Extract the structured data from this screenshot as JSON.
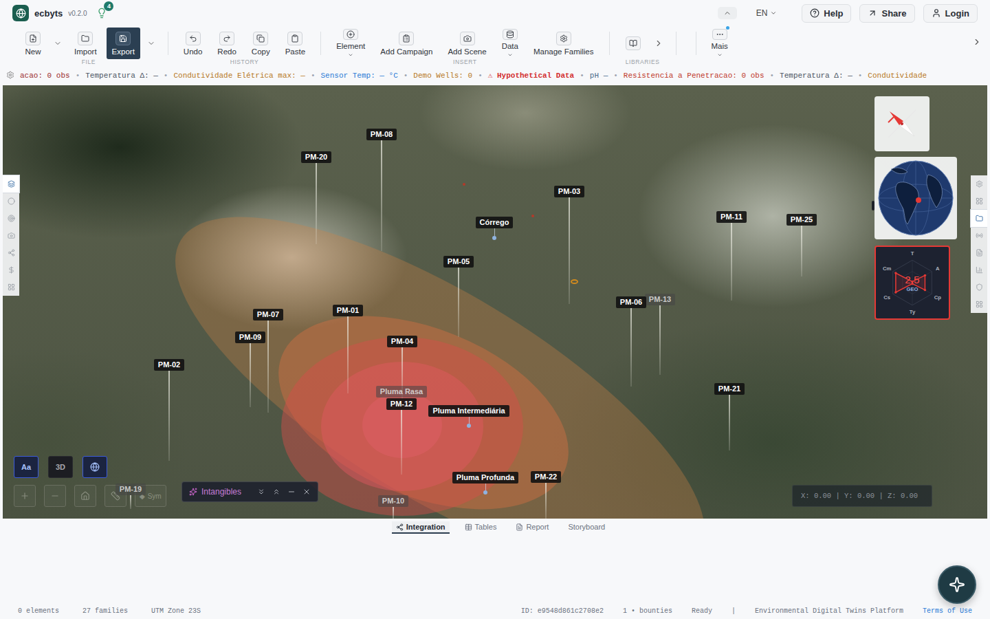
{
  "app": {
    "name": "ecbyts",
    "version": "v0.2.0",
    "notifications": "4"
  },
  "header_actions": {
    "language": "EN",
    "buttons": [
      "Help",
      "Share",
      "Login"
    ]
  },
  "toolbar": {
    "groups": [
      {
        "label": "FILE",
        "items": [
          {
            "kind": "button",
            "label": "New",
            "selected": false
          },
          {
            "kind": "caret",
            "selected": false
          },
          {
            "kind": "button",
            "label": "Import",
            "selected": false
          },
          {
            "kind": "button",
            "label": "Export",
            "selected": true
          },
          {
            "kind": "caret",
            "selected": false
          }
        ]
      },
      {
        "label": "HISTORY",
        "items": [
          {
            "kind": "button",
            "label": "Undo",
            "selected": false
          },
          {
            "kind": "button",
            "label": "Redo",
            "selected": false
          },
          {
            "kind": "button",
            "label": "Copy",
            "selected": false
          },
          {
            "kind": "button",
            "label": "Paste",
            "selected": false
          }
        ]
      },
      {
        "label": "INSERT",
        "items": [
          {
            "kind": "menu",
            "label": "Element",
            "selected": false
          },
          {
            "kind": "button",
            "label": "Add Campaign",
            "selected": false
          },
          {
            "kind": "button",
            "label": "Add Scene",
            "selected": false
          },
          {
            "kind": "menu",
            "label": "Data",
            "selected": false
          },
          {
            "kind": "button",
            "label": "Manage Families",
            "selected": false
          }
        ]
      },
      {
        "label": "LIBRARIES",
        "items": [
          {
            "kind": "icon",
            "selected": false
          },
          {
            "kind": "arrow",
            "selected": false
          }
        ]
      }
    ],
    "more": {
      "label": "Mais",
      "dot": true
    }
  },
  "ticker": {
    "separator": "•",
    "items": [
      {
        "text": "acao: 0 obs",
        "color": "#9b2c2c"
      },
      {
        "text": "Temperatura Δ: —",
        "color": "#4b5563"
      },
      {
        "text": "Condutividade Elétrica max: —",
        "color": "#b7791f"
      },
      {
        "text": "Sensor Temp: — °C",
        "color": "#2b7bd6"
      },
      {
        "text": "Demo Wells: 0",
        "color": "#b7791f"
      },
      {
        "text": "⚠ Hypothetical Data",
        "color": "#d32f2f"
      },
      {
        "text": "pH —",
        "color": "#4a6a8a"
      },
      {
        "text": "Resistencia a Penetracao: 0 obs",
        "color": "#c0392b"
      },
      {
        "text": "Temperatura Δ: —",
        "color": "#4b5563"
      },
      {
        "text": "Condutividade",
        "color": "#b7791f"
      }
    ]
  },
  "map": {
    "wells": [
      {
        "label": "PM-08",
        "kind": "well",
        "dimmed": false
      },
      {
        "label": "PM-20",
        "kind": "well",
        "dimmed": false
      },
      {
        "label": "PM-03",
        "kind": "well",
        "dimmed": false
      },
      {
        "label": "Córrego",
        "kind": "point",
        "dimmed": false
      },
      {
        "label": "PM-11",
        "kind": "well",
        "dimmed": false
      },
      {
        "label": "PM-25",
        "kind": "well",
        "dimmed": false
      },
      {
        "label": "PM-05",
        "kind": "well",
        "dimmed": false
      },
      {
        "label": "PM-07",
        "kind": "well",
        "dimmed": false
      },
      {
        "label": "PM-01",
        "kind": "well",
        "dimmed": false
      },
      {
        "label": "PM-13",
        "kind": "well",
        "dimmed": true
      },
      {
        "label": "PM-06",
        "kind": "well",
        "dimmed": false
      },
      {
        "label": "PM-09",
        "kind": "well",
        "dimmed": false
      },
      {
        "label": "PM-02",
        "kind": "well",
        "dimmed": false
      },
      {
        "label": "PM-21",
        "kind": "well",
        "dimmed": false
      },
      {
        "label": "PM-04",
        "kind": "well",
        "dimmed": false
      },
      {
        "label": "Pluma Rasa",
        "kind": "point",
        "dimmed": true
      },
      {
        "label": "PM-12",
        "kind": "well",
        "dimmed": false
      },
      {
        "label": "Pluma Intermediária",
        "kind": "point",
        "dimmed": false
      },
      {
        "label": "Pluma Profunda",
        "kind": "point",
        "dimmed": false
      },
      {
        "label": "PM-22",
        "kind": "well",
        "dimmed": false
      },
      {
        "label": "PM-10",
        "kind": "well",
        "dimmed": true
      },
      {
        "label": "PM-19",
        "kind": "well",
        "dimmed": true
      }
    ],
    "left_tools": [
      {
        "selected": true
      },
      {
        "selected": false
      },
      {
        "selected": false
      },
      {
        "selected": false
      },
      {
        "selected": false
      },
      {
        "selected": false
      },
      {
        "selected": false
      }
    ],
    "right_tools": [
      {
        "selected": false
      },
      {
        "selected": false
      },
      {
        "selected": true
      },
      {
        "selected": false
      },
      {
        "selected": false
      },
      {
        "selected": false
      },
      {
        "selected": false
      },
      {
        "selected": false
      }
    ],
    "radar": {
      "axes": [
        "T",
        "A",
        "Cp",
        "Ty",
        "Cs",
        "Cm"
      ],
      "values": [
        0.05,
        0.65,
        0.65,
        0.05,
        0.85,
        0.85
      ],
      "score": "2.5",
      "caption": "GEO"
    },
    "view_buttons": [
      {
        "kind": "text",
        "label": "Aa",
        "selected": true
      },
      {
        "kind": "text",
        "label": "3D",
        "selected": false
      },
      {
        "kind": "icon",
        "selected": true
      }
    ],
    "navigation": {
      "disabled": true,
      "symbol_glyph": "◆",
      "symbol_label": "Sym"
    },
    "intangibles": {
      "title": "Intangibles"
    },
    "coordinates": "X: 0.00 | Y: 0.00 | Z: 0.00"
  },
  "bottom_tabs": [
    {
      "label": "Integration",
      "selected": true
    },
    {
      "label": "Tables",
      "selected": false
    },
    {
      "label": "Report",
      "selected": false
    },
    {
      "label": "Storyboard",
      "selected": false
    }
  ],
  "status_bar": {
    "left": [
      "0 elements",
      "27 families",
      "UTM Zone 23S"
    ],
    "id": "ID: e9548d861c2708e2",
    "bounties": "1 • bounties",
    "state": "Ready",
    "divider": "|",
    "platform": "Environmental Digital Twins Platform",
    "terms": "Terms of Use"
  }
}
